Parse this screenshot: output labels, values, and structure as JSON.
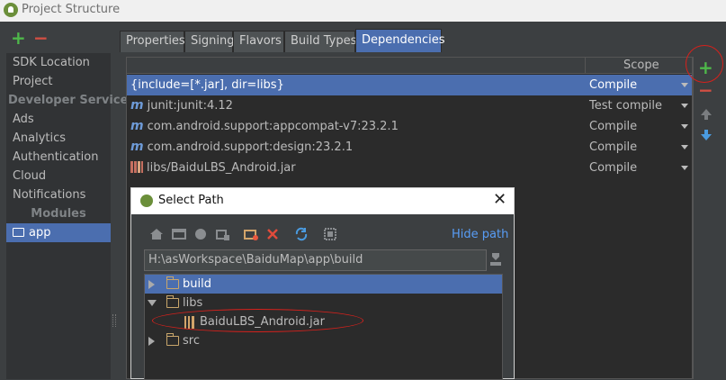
{
  "window": {
    "title": "Project Structure"
  },
  "left_toolbar": {
    "add": "+",
    "remove": "−"
  },
  "sidebar": {
    "items": [
      {
        "label": "SDK Location",
        "type": "item"
      },
      {
        "label": "Project",
        "type": "item"
      },
      {
        "label": "Developer Services",
        "type": "header"
      },
      {
        "label": "Ads",
        "type": "item"
      },
      {
        "label": "Analytics",
        "type": "item"
      },
      {
        "label": "Authentication",
        "type": "item"
      },
      {
        "label": "Cloud",
        "type": "item"
      },
      {
        "label": "Notifications",
        "type": "item"
      },
      {
        "label": "Modules",
        "type": "header"
      },
      {
        "label": "app",
        "type": "module",
        "selected": true
      }
    ]
  },
  "tabs": [
    {
      "label": "Properties"
    },
    {
      "label": "Signing"
    },
    {
      "label": "Flavors"
    },
    {
      "label": "Build Types"
    },
    {
      "label": "Dependencies",
      "active": true
    }
  ],
  "dependencies": {
    "column_scope": "Scope",
    "rows": [
      {
        "name": "{include=[*.jar], dir=libs}",
        "scope": "Compile",
        "icon": "none",
        "selected": true
      },
      {
        "name": "junit:junit:4.12",
        "scope": "Test compile",
        "icon": "maven-icon"
      },
      {
        "name": "com.android.support:appcompat-v7:23.2.1",
        "scope": "Compile",
        "icon": "maven-icon"
      },
      {
        "name": "com.android.support:design:23.2.1",
        "scope": "Compile",
        "icon": "maven-icon"
      },
      {
        "name": "libs/BaiduLBS_Android.jar",
        "scope": "Compile",
        "icon": "jar-icon"
      }
    ]
  },
  "right_toolbar": {
    "add": "+",
    "remove": "−"
  },
  "dialog": {
    "title": "Select Path",
    "close": "✕",
    "hide_path": "Hide path",
    "path": "H:\\asWorkspace\\BaiduMap\\app\\build",
    "tree": [
      {
        "label": "build",
        "expanded": false,
        "selected": true,
        "depth": 0,
        "kind": "folder"
      },
      {
        "label": "libs",
        "expanded": true,
        "depth": 0,
        "kind": "folder"
      },
      {
        "label": "BaiduLBS_Android.jar",
        "depth": 1,
        "kind": "jar"
      },
      {
        "label": "src",
        "expanded": false,
        "depth": 0,
        "kind": "folder"
      }
    ]
  },
  "colors": {
    "accent": "#4b6eaf",
    "add": "#4eb84a",
    "remove": "#d24f43",
    "callout": "#d6211c",
    "link": "#589df6"
  }
}
